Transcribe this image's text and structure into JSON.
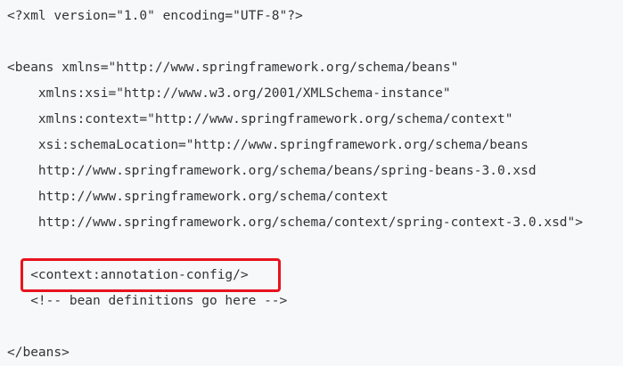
{
  "code": {
    "lines": [
      "<?xml version=\"1.0\" encoding=\"UTF-8\"?>",
      "",
      "<beans xmlns=\"http://www.springframework.org/schema/beans\"",
      "    xmlns:xsi=\"http://www.w3.org/2001/XMLSchema-instance\"",
      "    xmlns:context=\"http://www.springframework.org/schema/context\"",
      "    xsi:schemaLocation=\"http://www.springframework.org/schema/beans",
      "    http://www.springframework.org/schema/beans/spring-beans-3.0.xsd",
      "    http://www.springframework.org/schema/context",
      "    http://www.springframework.org/schema/context/spring-context-3.0.xsd\">",
      "",
      "   <context:annotation-config/>",
      "   <!-- bean definitions go here -->",
      "",
      "</beans>"
    ]
  },
  "colors": {
    "background": "#f6f8fa",
    "text": "#333333",
    "highlight_border": "#e8131f"
  }
}
